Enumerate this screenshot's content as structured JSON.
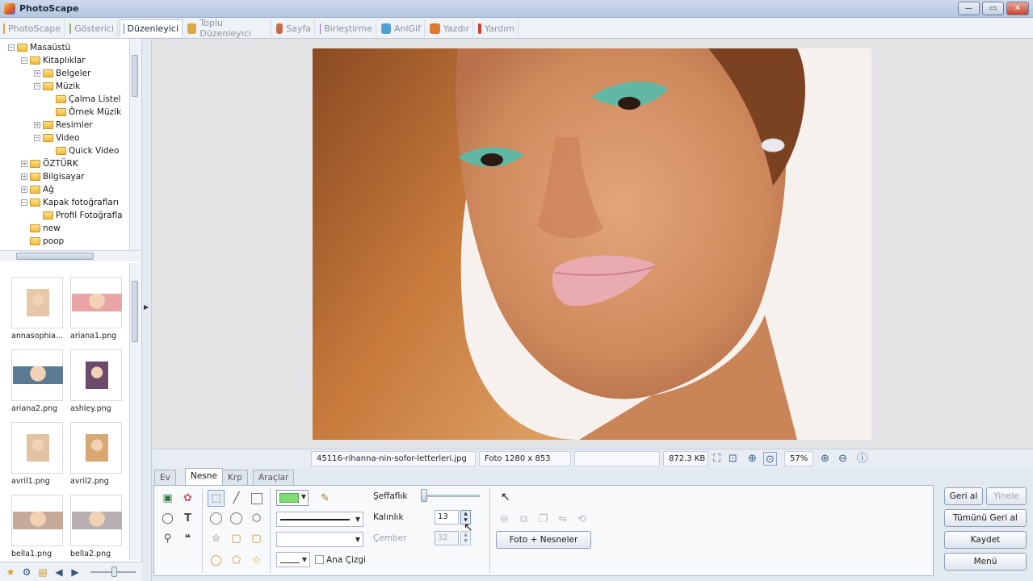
{
  "window": {
    "title": "PhotoScape"
  },
  "tabs": [
    {
      "label": "PhotoScape",
      "color": "#e3a23b"
    },
    {
      "label": "Gösterici",
      "color": "#8fb06a"
    },
    {
      "label": "Düzenleyici",
      "color": "#4b77c7"
    },
    {
      "label": "Toplu Düzenleyici",
      "color": "#d9a847"
    },
    {
      "label": "Sayfa",
      "color": "#c46b4a"
    },
    {
      "label": "Birleştirme",
      "color": "#9b6fd0"
    },
    {
      "label": "AniGif",
      "color": "#4ea2cf"
    },
    {
      "label": "Yazdır",
      "color": "#e07a2e"
    },
    {
      "label": "Yardım",
      "color": "#d23a2e"
    }
  ],
  "tree": [
    {
      "label": "Masaüstü",
      "indent": 0,
      "exp": "-"
    },
    {
      "label": "Kitaplıklar",
      "indent": 1,
      "exp": "-"
    },
    {
      "label": "Belgeler",
      "indent": 2,
      "exp": "+"
    },
    {
      "label": "Müzik",
      "indent": 2,
      "exp": "-"
    },
    {
      "label": "Çalma Listel",
      "indent": 3,
      "exp": ""
    },
    {
      "label": "Örnek Müzik",
      "indent": 3,
      "exp": ""
    },
    {
      "label": "Resimler",
      "indent": 2,
      "exp": "+"
    },
    {
      "label": "Video",
      "indent": 2,
      "exp": "-"
    },
    {
      "label": "Quick Video",
      "indent": 3,
      "exp": ""
    },
    {
      "label": "ÖZTÜRK",
      "indent": 1,
      "exp": "+"
    },
    {
      "label": "Bilgisayar",
      "indent": 1,
      "exp": "+"
    },
    {
      "label": "Ağ",
      "indent": 1,
      "exp": "+"
    },
    {
      "label": "Kapak fotoğrafları",
      "indent": 1,
      "exp": "-"
    },
    {
      "label": "Profil Fotoğrafla",
      "indent": 2,
      "exp": ""
    },
    {
      "label": "new",
      "indent": 1,
      "exp": ""
    },
    {
      "label": "poop",
      "indent": 1,
      "exp": ""
    }
  ],
  "thumbnails": [
    {
      "name": "annasophia...",
      "color": "#e6c8a8",
      "wide": false
    },
    {
      "name": "ariana1.png",
      "color": "#e9a5a5",
      "wide": true
    },
    {
      "name": "ariana2.png",
      "color": "#5a7a92",
      "wide": true
    },
    {
      "name": "ashley.png",
      "color": "#6b4a6a",
      "wide": false
    },
    {
      "name": "avril1.png",
      "color": "#e2c4a4",
      "wide": false
    },
    {
      "name": "avril2.png",
      "color": "#d8a872",
      "wide": false
    },
    {
      "name": "bella1.png",
      "color": "#c7a99a",
      "wide": true
    },
    {
      "name": "bella2.png",
      "color": "#b6aeb0",
      "wide": true
    }
  ],
  "statusbar": {
    "filename": "45116-rihanna-nin-sofor-letterleri.jpg",
    "dimensions": "Foto 1280 x 853",
    "filesize": "872.3 KB",
    "zoom": "57%"
  },
  "editor_tabs": [
    "Ev",
    "Nesne",
    "Krp",
    "Araçlar"
  ],
  "editor": {
    "transparency_label": "Şeffaflık",
    "thickness_label": "Kalınlık",
    "thickness_value": "13",
    "circle_label": "Çember",
    "circle_value": "32",
    "outline_label": "Ana Çizgi",
    "photo_objects_button": "Foto + Nesneler",
    "fill_color": "#7fdc72",
    "transparency_level": 0
  },
  "right_buttons": {
    "undo": "Geri al",
    "redo": "Yinele",
    "undo_all": "Tümünü Geri al",
    "save": "Kaydet",
    "menu": "Menü"
  }
}
